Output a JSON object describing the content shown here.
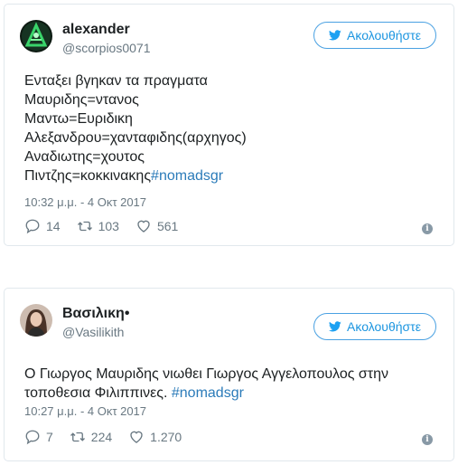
{
  "colors": {
    "link": "#2b7bb9",
    "follow": "#1b95e0",
    "muted": "#697882",
    "border": "#e1e8ed"
  },
  "tweets": [
    {
      "author": {
        "name": "alexander",
        "handle": "@scorpios0071",
        "avatar": "avatar-green-logo"
      },
      "follow_label": "Ακολουθήστε",
      "lines": [
        "Ενταξει βγηκαν τα πραγματα",
        "Μαυριδης=ντανος",
        "Μαντω=Ευριδικη",
        "Αλεξανδρου=χανταφιδης(αρχηγος)",
        "Αναδιωτης=χουτος"
      ],
      "last_line": "Πιντζης=κοκκινακης",
      "hashtag": "#nomadsgr",
      "time": "10:32 μ.μ. - 4 Οκτ 2017",
      "replies": "14",
      "retweets": "103",
      "likes": "561"
    },
    {
      "author": {
        "name": "Βασιλικη",
        "name_glyph": "•",
        "handle": "@Vasilikith",
        "avatar": "avatar-photo"
      },
      "follow_label": "Ακολουθήστε",
      "lines": [
        "Ο Γιωργος Μαυριδης νιωθει Γιωργος Αγγελοπουλος στην"
      ],
      "last_line": "τοποθεσια Φιλιππινες. ",
      "hashtag": "#nomadsgr",
      "time": "10:27 μ.μ. - 4 Οκτ 2017",
      "replies": "7",
      "retweets": "224",
      "likes": "1.270"
    }
  ]
}
